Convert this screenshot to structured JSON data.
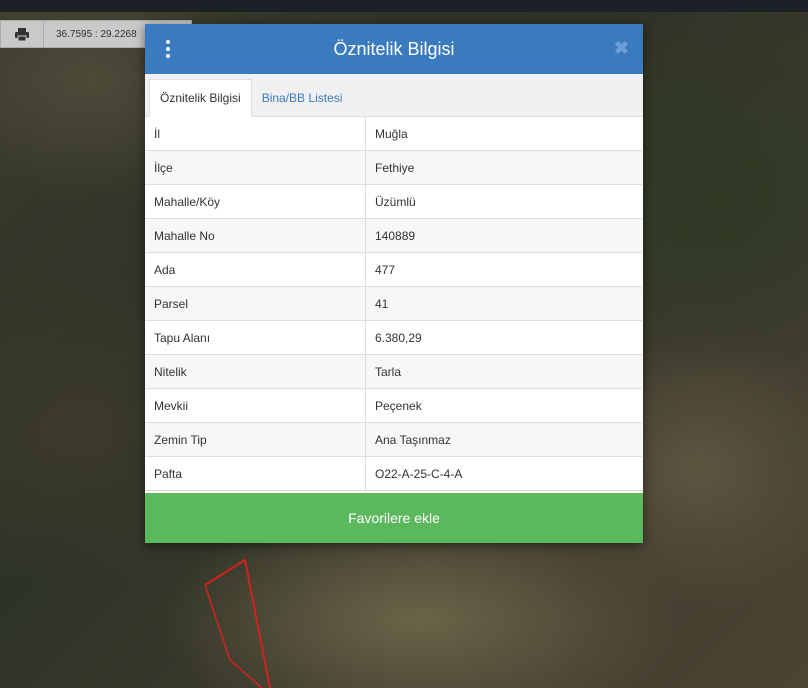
{
  "coords": {
    "text": "36.7595 : 29.2268"
  },
  "modal": {
    "title": "Öznitelik Bilgisi",
    "close_symbol": "✖",
    "tabs": [
      {
        "label": "Öznitelik Bilgisi",
        "active": true
      },
      {
        "label": "Bina/BB Listesi",
        "active": false
      }
    ],
    "rows": [
      {
        "key": "İl",
        "value": "Muğla"
      },
      {
        "key": "İlçe",
        "value": "Fethiye"
      },
      {
        "key": "Mahalle/Köy",
        "value": "Üzümlü"
      },
      {
        "key": "Mahalle No",
        "value": "140889"
      },
      {
        "key": "Ada",
        "value": "477"
      },
      {
        "key": "Parsel",
        "value": "41"
      },
      {
        "key": "Tapu Alanı",
        "value": "6.380,29"
      },
      {
        "key": "Nitelik",
        "value": "Tarla"
      },
      {
        "key": "Mevkii",
        "value": "Peçenek"
      },
      {
        "key": "Zemin Tip",
        "value": "Ana Taşınmaz"
      },
      {
        "key": "Pafta",
        "value": "O22-A-25-C-4-A"
      }
    ],
    "favorite_label": "Favorilere ekle"
  },
  "colors": {
    "header": "#3a7bc0",
    "favorite_button": "#5cb85c",
    "boundary": "#d32020"
  },
  "icons": {
    "print": "print-icon",
    "menu": "kebab-menu-icon",
    "close": "close-icon"
  }
}
